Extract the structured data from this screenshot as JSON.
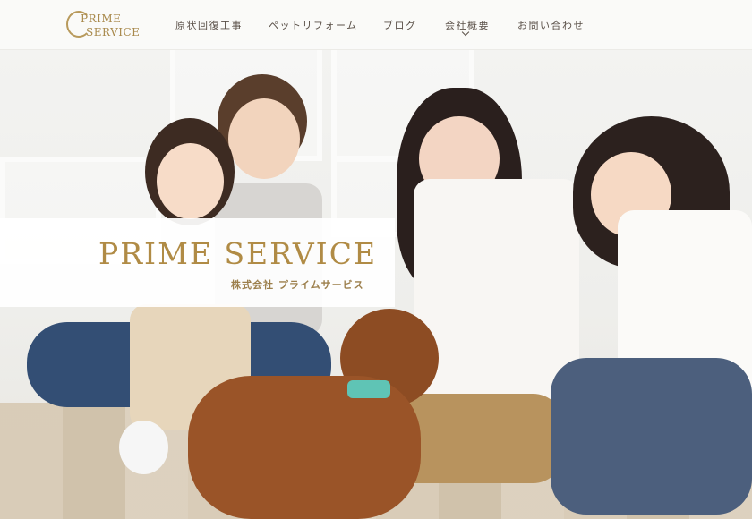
{
  "site": {
    "logo_line1": "PRIME",
    "logo_line2": "SERVICE"
  },
  "nav": {
    "items": [
      {
        "label": "原状回復工事"
      },
      {
        "label": "ペットリフォーム"
      },
      {
        "label": "ブログ"
      },
      {
        "label": "会社概要",
        "has_dropdown": true
      },
      {
        "label": "お問い合わせ"
      }
    ]
  },
  "hero": {
    "brand_name": "PRIME SERVICE",
    "company_name": "株式会社 プライムサービス"
  },
  "colors": {
    "brand_gold": "#b08b45",
    "nav_text": "#5a5048",
    "header_bg": "#fafaf9"
  }
}
